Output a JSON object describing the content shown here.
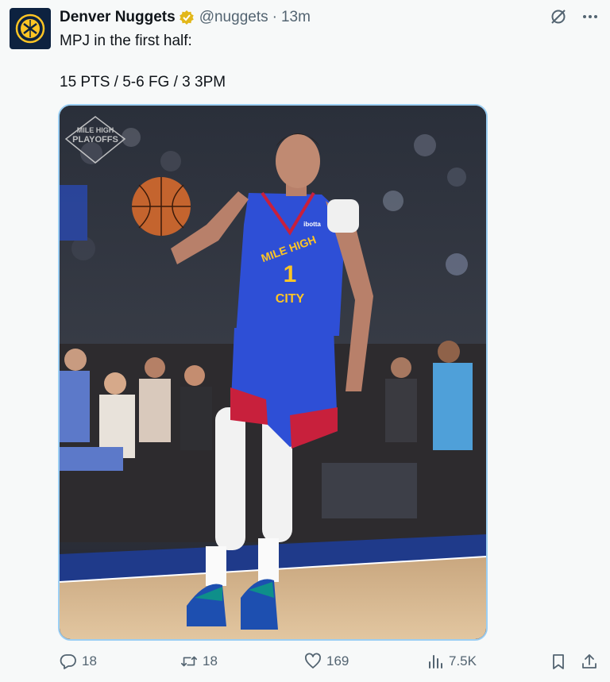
{
  "tweet": {
    "author_name": "Denver Nuggets",
    "handle": "@nuggets",
    "separator": "·",
    "timestamp": "13m",
    "text_line1": "MPJ in the first half:",
    "text_line2": "15 PTS / 5-6 FG / 3 3PM"
  },
  "media": {
    "watermark_line1": "MILE HIGH",
    "watermark_line2": "PLAYOFFS",
    "jersey_line1": "MILE HIGH",
    "jersey_number": "1",
    "jersey_line2": "CITY",
    "jersey_sponsor": "ibotta"
  },
  "actions": {
    "reply_count": "18",
    "retweet_count": "18",
    "like_count": "169",
    "views_count": "7.5K"
  },
  "icons": {
    "verified": "verified-badge-icon",
    "grok": "grok-icon",
    "more": "more-icon",
    "reply": "reply-icon",
    "retweet": "retweet-icon",
    "like": "like-icon",
    "views": "views-icon",
    "bookmark": "bookmark-icon",
    "share": "share-icon"
  },
  "colors": {
    "brand_navy": "#0d2240",
    "gold": "#fec524",
    "jersey_blue": "#2e4fd6",
    "jersey_red": "#c8203c",
    "verified_gold": "#e2b719"
  }
}
